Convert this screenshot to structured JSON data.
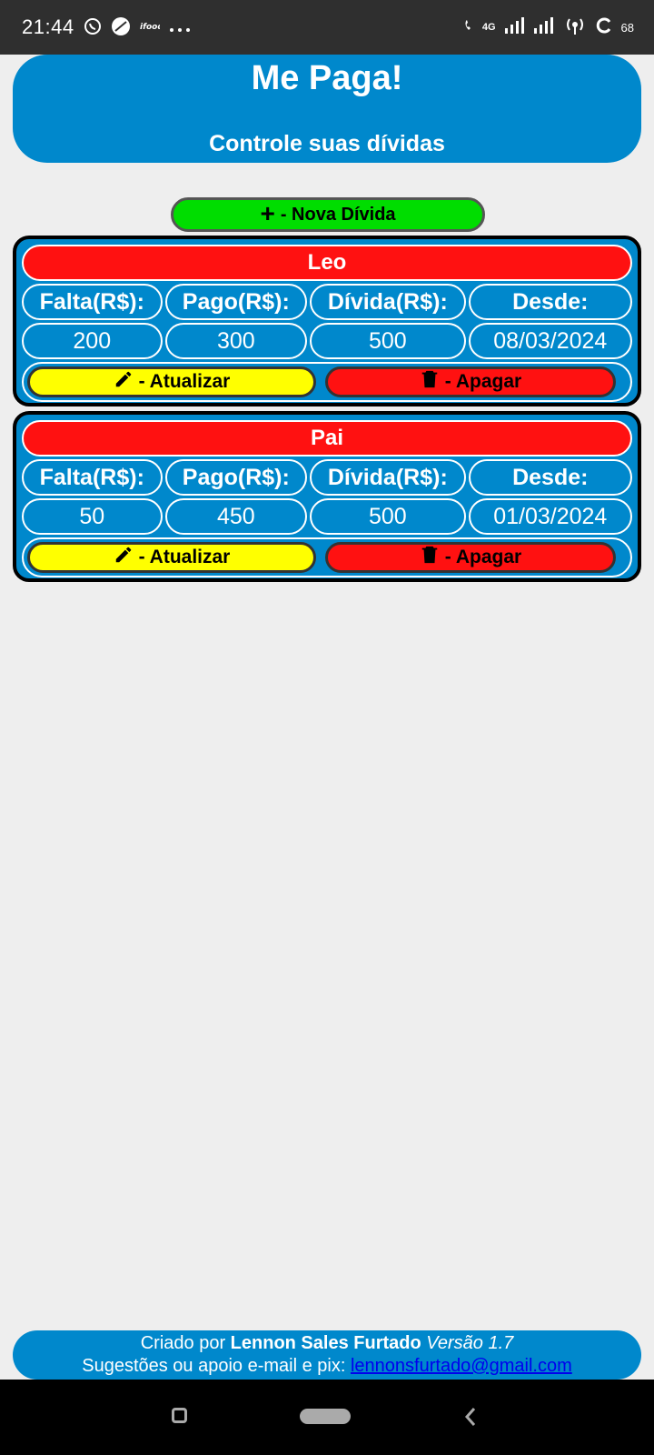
{
  "status_bar": {
    "time": "21:44",
    "network": "4G",
    "battery": "68",
    "icons_left": [
      "whatsapp-icon",
      "browser-icon",
      "ifood-icon",
      "more-icon"
    ],
    "icons_right": [
      "phone-icon",
      "signal-icon",
      "signal-icon",
      "hotspot-icon",
      "battery-icon"
    ]
  },
  "header": {
    "title": "Me Paga!",
    "subtitle": "Controle suas dívidas"
  },
  "new_debt_button": {
    "icon": "plus-icon",
    "label": "- Nova Dívida"
  },
  "column_headers": {
    "remaining": "Falta(R$):",
    "paid": "Pago(R$):",
    "debt": "Dívida(R$):",
    "since": "Desde:"
  },
  "debts": [
    {
      "name": "Leo",
      "remaining": "200",
      "paid": "300",
      "debt": "500",
      "since": "08/03/2024",
      "update_label": "- Atualizar",
      "delete_label": "- Apagar"
    },
    {
      "name": "Pai",
      "remaining": "50",
      "paid": "450",
      "debt": "500",
      "since": "01/03/2024",
      "update_label": "- Atualizar",
      "delete_label": "- Apagar"
    }
  ],
  "footer": {
    "created_by": "Criado por",
    "author": "Lennon Sales Furtado",
    "version": "Versão 1.7",
    "support_text": "Sugestões ou apoio e-mail e pix:",
    "email": "lennonsfurtado@gmail.com"
  },
  "colors": {
    "primary": "#0088cc",
    "new_button": "#00dd00",
    "name_badge": "#ff1111",
    "update_button": "#ffff00",
    "delete_button": "#ff1111",
    "background": "#eeeeee"
  }
}
